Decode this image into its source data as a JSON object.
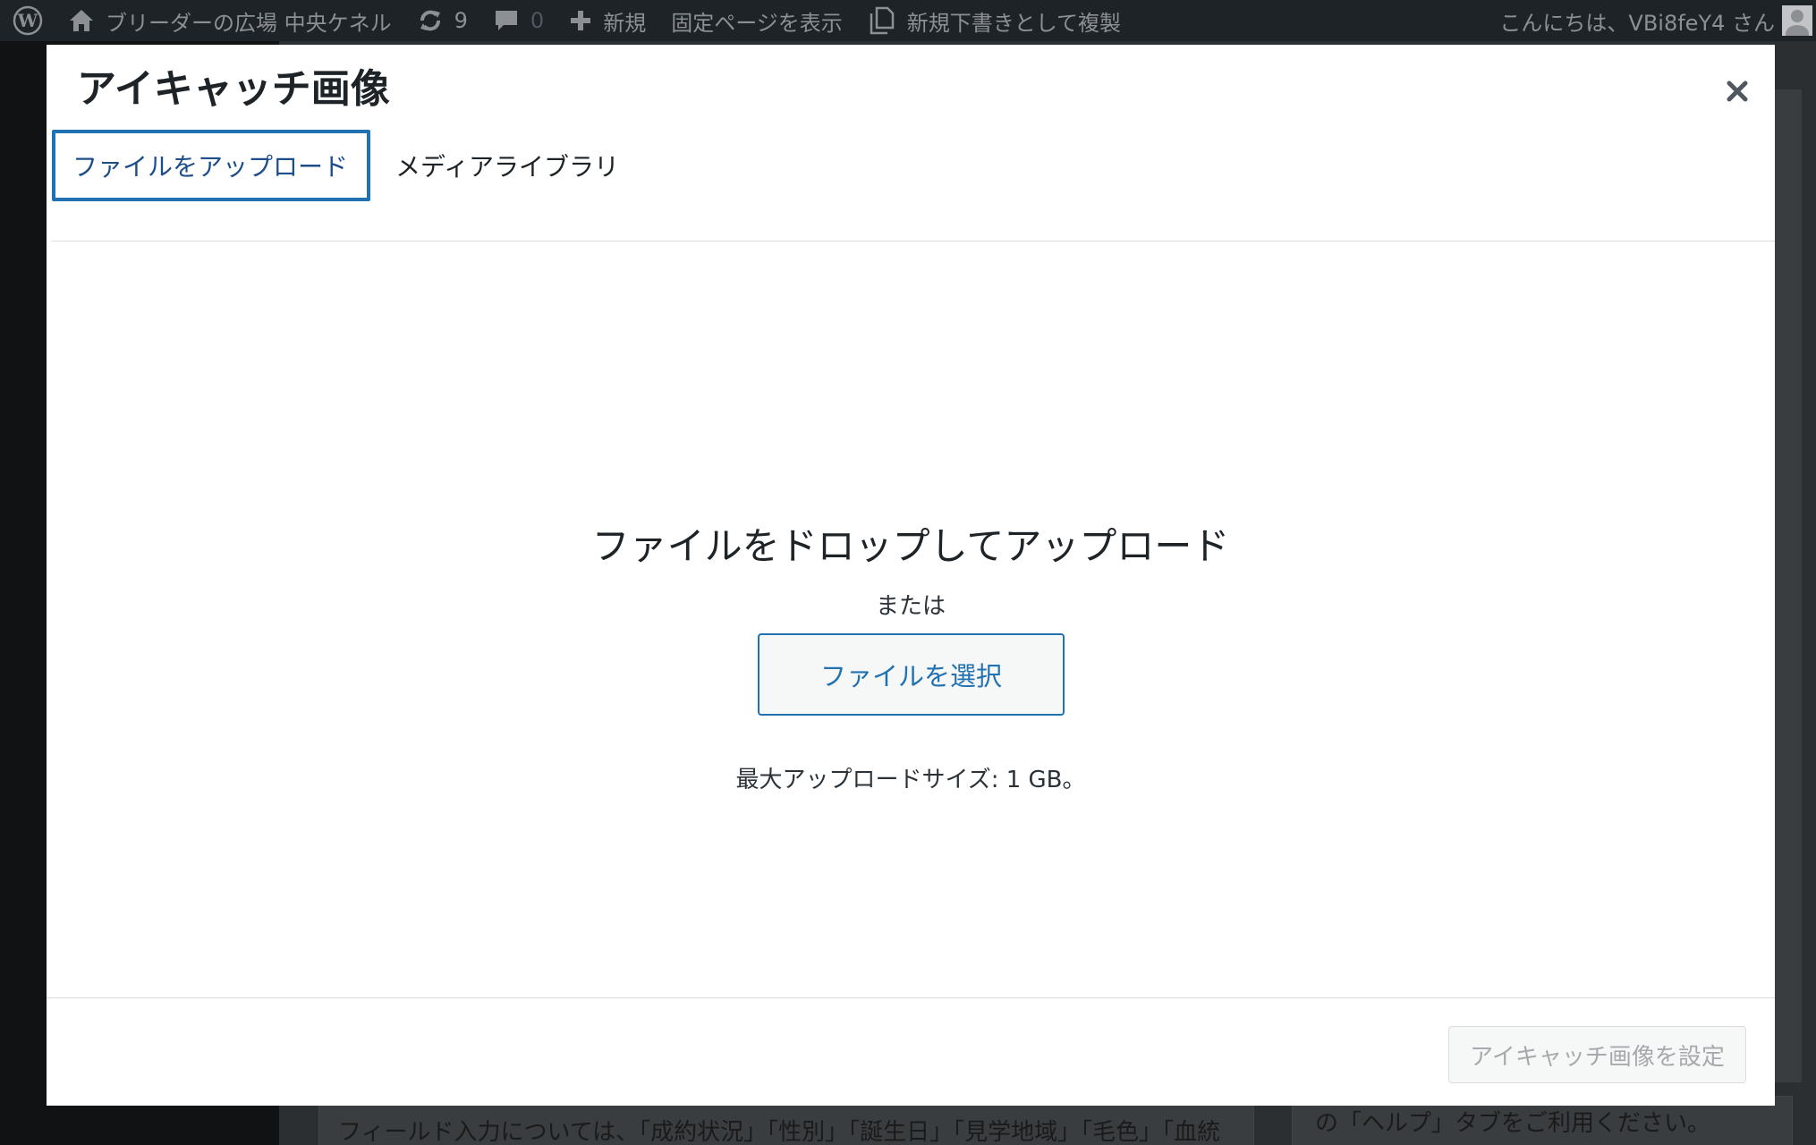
{
  "admin_bar": {
    "logo_icon": "wordpress-icon",
    "site_icon": "home-icon",
    "site_name": "ブリーダーの広場 中央ケネル",
    "updates_icon": "refresh-icon",
    "updates_count": "9",
    "comments_icon": "comment-icon",
    "comments_count": "0",
    "new_icon": "plus-icon",
    "new_label": "新規",
    "view_page_label": "固定ページを表示",
    "duplicate_icon": "copy-icon",
    "duplicate_label": "新規下書きとして複製",
    "greeting": "こんにちは、VBi8feY4 さん"
  },
  "background": {
    "left_text": "フィールド入力については、「成約状況」「性別」「誕生日」「見学地域」「毛色」「血統",
    "right_text": "の「ヘルプ」タブをご利用ください。"
  },
  "modal": {
    "title": "アイキャッチ画像",
    "close_icon": "close-icon",
    "tabs": [
      {
        "label": "ファイルをアップロード",
        "active": true
      },
      {
        "label": "メディアライブラリ",
        "active": false
      }
    ],
    "uploader": {
      "drop_text": "ファイルをドロップしてアップロード",
      "or_text": "または",
      "select_button": "ファイルを選択",
      "max_size": "最大アップロードサイズ: 1 GB。"
    },
    "footer": {
      "set_button": "アイキャッチ画像を設定"
    }
  },
  "colors": {
    "admin_bar_bg": "#1d2327",
    "accent": "#2271b1",
    "modal_bg": "#ffffff"
  }
}
